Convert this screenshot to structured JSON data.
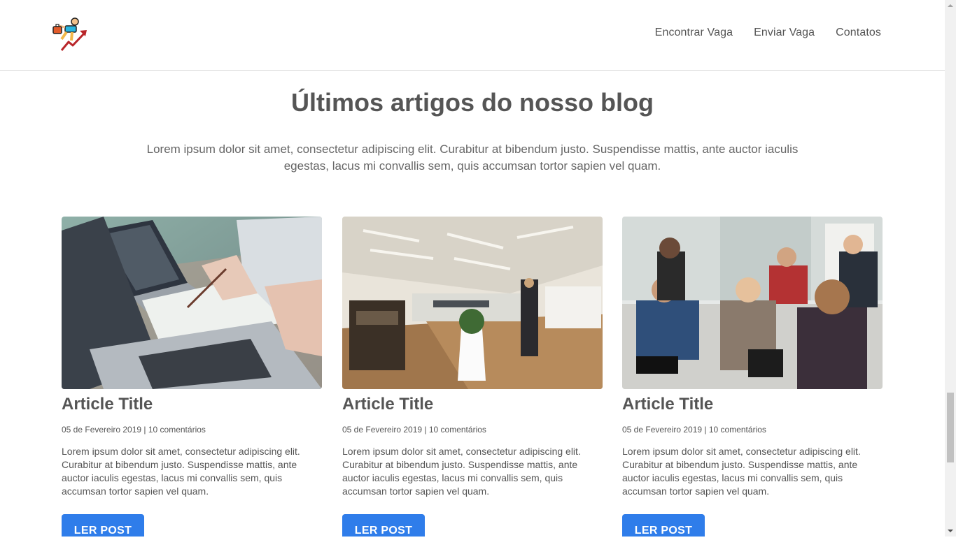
{
  "header": {
    "logo": {
      "icon": "climbing-man-arrow-logo"
    },
    "nav": [
      {
        "label": "Encontrar Vaga"
      },
      {
        "label": "Enviar Vaga"
      },
      {
        "label": "Contatos"
      }
    ]
  },
  "blog": {
    "title": "Últimos artigos do nosso blog",
    "intro": "Lorem ipsum dolor sit amet, consectetur adipiscing elit. Curabitur at bibendum justo. Suspendisse mattis, ante auctor iaculis egestas, lacus mi convallis sem, quis accumsan tortor sapien vel quam.",
    "articles": [
      {
        "image": "laptops-notes-meeting-photo",
        "title": "Article Title",
        "meta": "05 de Fevereiro 2019 | 10 comentários",
        "excerpt": "Lorem ipsum dolor sit amet, consectetur adipiscing elit. Curabitur at bibendum justo. Suspendisse mattis, ante auctor iaculis egestas, lacus mi convallis sem, quis accumsan tortor sapien vel quam.",
        "button": "LER POST"
      },
      {
        "image": "open-office-interior-photo",
        "title": "Article Title",
        "meta": "05 de Fevereiro 2019 | 10 comentários",
        "excerpt": "Lorem ipsum dolor sit amet, consectetur adipiscing elit. Curabitur at bibendum justo. Suspendisse mattis, ante auctor iaculis egestas, lacus mi convallis sem, quis accumsan tortor sapien vel quam.",
        "button": "LER POST"
      },
      {
        "image": "team-meeting-photo",
        "title": "Article Title",
        "meta": "05 de Fevereiro 2019 | 10 comentários",
        "excerpt": "Lorem ipsum dolor sit amet, consectetur adipiscing elit. Curabitur at bibendum justo. Suspendisse mattis, ante auctor iaculis egestas, lacus mi convallis sem, quis accumsan tortor sapien vel quam.",
        "button": "LER POST"
      }
    ]
  },
  "colors": {
    "accent": "#2f7dea",
    "text": "#555555",
    "divider": "#d8d8d8"
  },
  "scrollbar": {
    "position": 0.78
  }
}
